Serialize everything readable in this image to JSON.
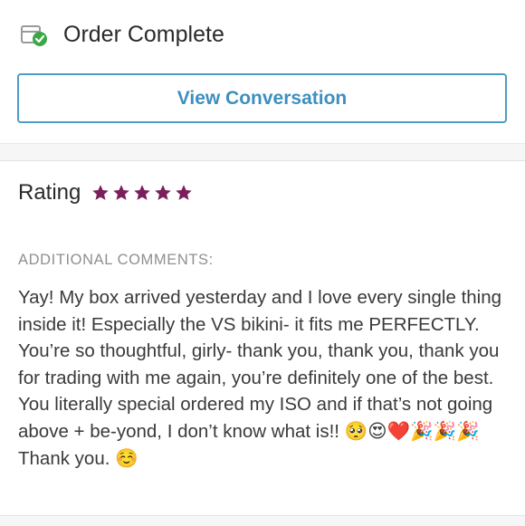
{
  "header": {
    "status_icon": "box-check-icon",
    "title": "Order Complete"
  },
  "actions": {
    "view_conversation_label": "View Conversation"
  },
  "rating": {
    "label": "Rating",
    "stars": 5,
    "max_stars": 5,
    "star_icon": "star-icon",
    "star_color": "#7a1f5c"
  },
  "comments": {
    "label": "ADDITIONAL COMMENTS:",
    "text": "Yay! My box arrived yesterday and I love every single thing inside it! Especially the VS bikini- it fits me PERFECTLY. You’re so thoughtful, girly- thank you, thank you, thank you for trading with me again, you’re definitely one of the best. You literally special ordered my ISO and if that’s not going above + be-yond, I don’t know what is!! 🥺😍❤️🎉🎉🎉 Thank you. ☺️"
  },
  "colors": {
    "accent": "#3d8fbf",
    "check_green": "#3aa845",
    "muted_label": "#8f8f8f"
  }
}
